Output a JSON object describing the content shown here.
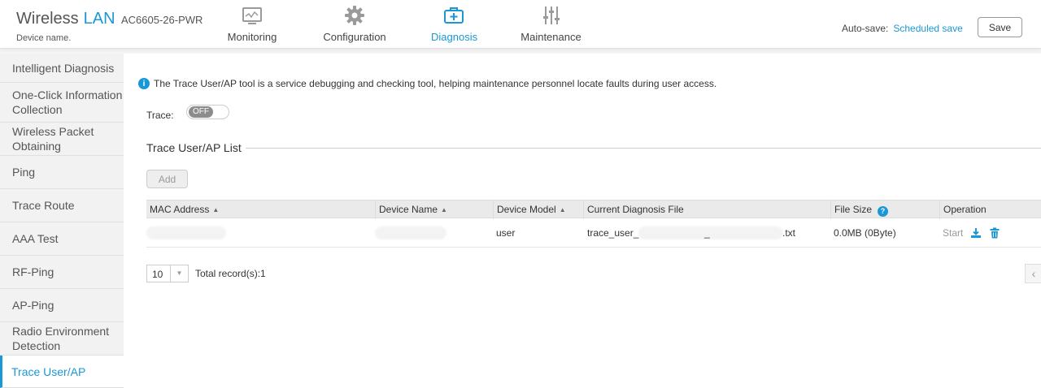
{
  "header": {
    "brand": "Wireless",
    "brand_accent": "LAN",
    "model": "AC6605-26-PWR",
    "device_name_label": "Device name.",
    "nav": [
      {
        "label": "Monitoring",
        "icon": "monitor-icon"
      },
      {
        "label": "Configuration",
        "icon": "gear-icon"
      },
      {
        "label": "Diagnosis",
        "icon": "medical-kit-icon",
        "active": true
      },
      {
        "label": "Maintenance",
        "icon": "sliders-icon"
      }
    ],
    "autosave_label": "Auto-save:",
    "autosave_value": "Scheduled save",
    "save_label": "Save"
  },
  "sidebar": {
    "items": [
      {
        "label": "Intelligent Diagnosis"
      },
      {
        "label": "One-Click Information Collection"
      },
      {
        "label": "Wireless Packet Obtaining"
      },
      {
        "label": "Ping"
      },
      {
        "label": "Trace Route"
      },
      {
        "label": "AAA Test"
      },
      {
        "label": "RF-Ping"
      },
      {
        "label": "AP-Ping"
      },
      {
        "label": "Radio Environment Detection"
      },
      {
        "label": "Trace User/AP",
        "active": true
      }
    ]
  },
  "main": {
    "info_text": "The Trace User/AP tool is a service debugging and checking tool, helping maintenance personnel locate faults during user access.",
    "trace_label": "Trace:",
    "trace_toggle": "OFF",
    "section_title": "Trace User/AP List",
    "add_label": "Add",
    "table": {
      "columns": [
        "MAC Address",
        "Device Name",
        "Device Model",
        "Current Diagnosis File",
        "File Size",
        "Operation"
      ],
      "rows": [
        {
          "mac": "",
          "device_name": "",
          "device_model": "user",
          "file_prefix": "trace_user_",
          "file_mid": "_",
          "file_suffix": ".txt",
          "file_size": "0.0MB (0Byte)",
          "op_start": "Start"
        }
      ]
    },
    "pagination": {
      "page_size": "10",
      "total": "Total record(s):1"
    }
  },
  "colors": {
    "accent": "#1a98d6"
  }
}
